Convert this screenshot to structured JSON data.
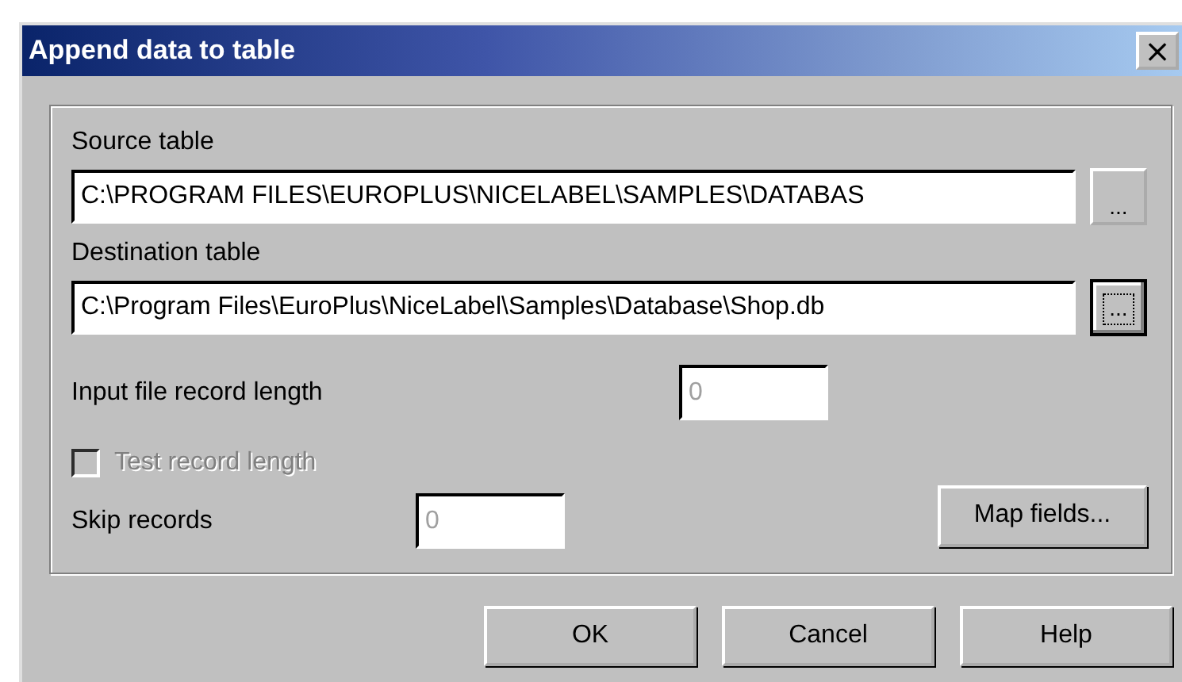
{
  "window": {
    "title": "Append data to table",
    "close": "×"
  },
  "source_table": {
    "label": "Source table",
    "value": "C:\\PROGRAM FILES\\EUROPLUS\\NICELABEL\\SAMPLES\\DATABAS",
    "browse": "...",
    "focused": false
  },
  "destination_table": {
    "label": "Destination table",
    "value": "C:\\Program Files\\EuroPlus\\NiceLabel\\Samples\\Database\\Shop.db",
    "browse": "...",
    "focused": true
  },
  "record_length": {
    "label": "Input file record length",
    "value": "0",
    "disabled": true
  },
  "test_record_length": {
    "label": "Test record length",
    "checked": false,
    "disabled": true
  },
  "skip_records": {
    "label": "Skip records",
    "value": "0",
    "disabled": true
  },
  "map_fields": "Map fields...",
  "buttons": [
    "OK",
    "Cancel",
    "Help"
  ]
}
